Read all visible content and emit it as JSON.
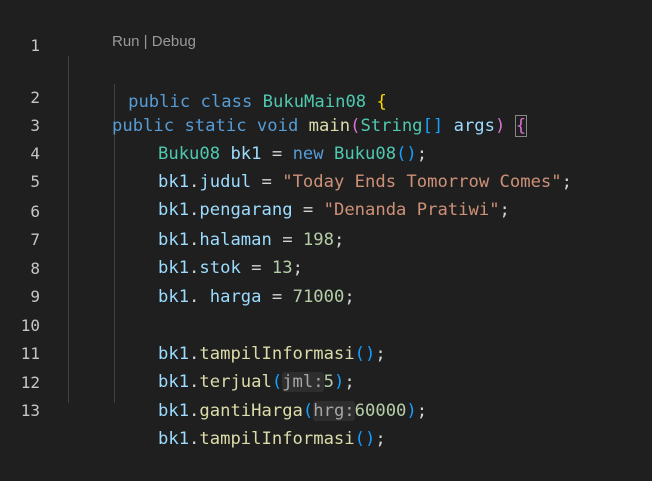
{
  "editor": {
    "line_numbers": [
      "1",
      "2",
      "3",
      "4",
      "5",
      "6",
      "7",
      "8",
      "9",
      "10",
      "11",
      "12",
      "13"
    ],
    "codelens": "Run | Debug",
    "lines": {
      "l1": {
        "kw1": "public",
        "kw2": "class",
        "name": "BukuMain08",
        "brace": "{"
      },
      "l2": {
        "kw1": "public",
        "kw2": "static",
        "kw3": "void",
        "fn": "main",
        "p1": "(",
        "ty": "String",
        "arr": "[]",
        "param": "args",
        "p2": ")",
        "brace": "{"
      },
      "l3": {
        "ty": "Buku08",
        "var": "bk1",
        "eq": "=",
        "kw": "new",
        "ctor": "Buku08",
        "parens": "()",
        "semi": ";"
      },
      "l4": {
        "obj": "bk1",
        "dot": ".",
        "field": "judul",
        "eq": "=",
        "str": "\"Today Ends Tomorrow Comes\"",
        "semi": ";"
      },
      "l5": {
        "obj": "bk1",
        "dot": ".",
        "field": "pengarang",
        "eq": "=",
        "str": "\"Denanda Pratiwi\"",
        "semi": ";"
      },
      "l6": {
        "obj": "bk1",
        "dot": ".",
        "field": "halaman",
        "eq": "=",
        "num": "198",
        "semi": ";"
      },
      "l7": {
        "obj": "bk1",
        "dot": ".",
        "field": "stok",
        "eq": "=",
        "num": "13",
        "semi": ";"
      },
      "l8": {
        "obj": "bk1",
        "dot": ".",
        "field": "harga",
        "eq": "=",
        "num": "71000",
        "semi": ";"
      },
      "l10": {
        "obj": "bk1",
        "dot": ".",
        "fn": "tampilInformasi",
        "parens": "()",
        "semi": ";"
      },
      "l11": {
        "obj": "bk1",
        "dot": ".",
        "fn": "terjual",
        "p1": "(",
        "hint": "jml:",
        "num": "5",
        "p2": ")",
        "semi": ";"
      },
      "l12": {
        "obj": "bk1",
        "dot": ".",
        "fn": "gantiHarga",
        "p1": "(",
        "hint": "hrg:",
        "num": "60000",
        "p2": ")",
        "semi": ";"
      },
      "l13": {
        "obj": "bk1",
        "dot": ".",
        "fn": "tampilInformasi",
        "parens": "()",
        "semi": ";"
      }
    }
  },
  "colors": {
    "background": "#1f1f1f",
    "keyword": "#569cd6",
    "type": "#4ec9b0",
    "function": "#dcdcaa",
    "variable": "#9cdcfe",
    "string": "#ce9178",
    "number": "#b5cea8",
    "bracket1": "#ffd700",
    "bracket2": "#da70d6",
    "bracket3": "#179fff"
  }
}
